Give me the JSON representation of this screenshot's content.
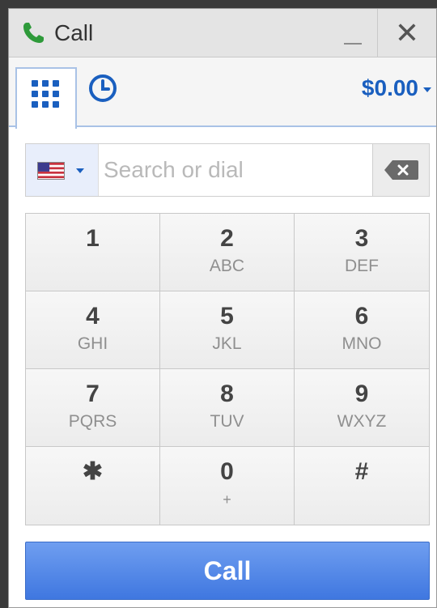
{
  "titlebar": {
    "title": "Call",
    "minimize_label": "_",
    "close_label": "✕",
    "phone_icon_color": "#2e9a3a"
  },
  "tabs": {
    "keypad_icon": "keypad-icon",
    "history_icon": "clock-icon",
    "credit": "$0.00"
  },
  "dial": {
    "country_flag": "us-flag-icon",
    "placeholder": "Search or dial",
    "value": "",
    "backspace_icon": "backspace-icon"
  },
  "keypad": {
    "keys": [
      {
        "digit": "1",
        "letters": ""
      },
      {
        "digit": "2",
        "letters": "ABC"
      },
      {
        "digit": "3",
        "letters": "DEF"
      },
      {
        "digit": "4",
        "letters": "GHI"
      },
      {
        "digit": "5",
        "letters": "JKL"
      },
      {
        "digit": "6",
        "letters": "MNO"
      },
      {
        "digit": "7",
        "letters": "PQRS"
      },
      {
        "digit": "8",
        "letters": "TUV"
      },
      {
        "digit": "9",
        "letters": "WXYZ"
      },
      {
        "digit": "✱",
        "letters": ""
      },
      {
        "digit": "0",
        "letters": "+"
      },
      {
        "digit": "#",
        "letters": ""
      }
    ]
  },
  "call_button": {
    "label": "Call"
  },
  "colors": {
    "accent": "#1a5fbf",
    "call_button": "#4a80e6"
  }
}
